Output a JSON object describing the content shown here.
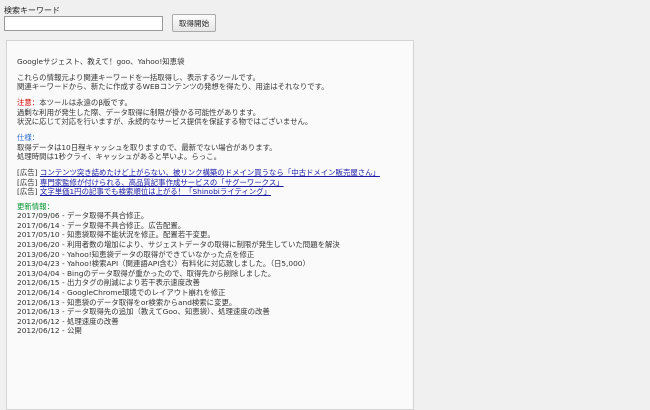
{
  "search": {
    "label": "検索キーワード",
    "value": "",
    "placeholder": "",
    "button_label": "取得開始"
  },
  "intro": {
    "title": "Googleサジェスト、教えて！goo、Yahoo!知恵袋",
    "desc_line1": "これらの情報元より関連キーワードを一括取得し、表示するツールです。",
    "desc_line2": "関連キーワードから、新たに作成するWEBコンテンツの発想を得たり、用途はそれなりです。"
  },
  "notice": {
    "label": "注意：",
    "line1": "本ツールは永遠のβ版です。",
    "line2": "過剰な利用が発生した際、データ取得に制限が掛かる可能性があります。",
    "line3": "状況に応じて対応を行いますが、永続的なサービス提供を保証する物ではございません。"
  },
  "spec": {
    "label": "仕様：",
    "line1": "取得データは10日程キャッシュを取りますので、最新でない場合があります。",
    "line2": "処理時間は1秒クライ、キャッシュがあると早いよ。らっこ。"
  },
  "ads": [
    {
      "tag": "[広告]",
      "text": "コンテンツ突き詰めたけど上がらない、被リンク構築のドメイン買うなら「中古ドメイン販売屋さん」"
    },
    {
      "tag": "[広告]",
      "text": "専門家監修が付けられる、高品質記事作成サービスの「サグーワークス」"
    },
    {
      "tag": "[広告]",
      "text": "文字単価1円の記事でも検索順位は上がる！「Shinobiライティング」"
    }
  ],
  "changelog": {
    "label": "更新情報：",
    "entries": [
      "2017/09/06 - データ取得不具合修正。",
      "2017/06/14 - データ取得不具合修正。広告配置。",
      "2017/05/10 - 知恵袋取得不能状況を修正。配置若干変更。",
      "2013/06/20 - 利用者数の増加により、サジェストデータの取得に制限が発生していた問題を解決",
      "2013/06/20 - Yahoo!知恵袋データの取得ができていなかった点を修正",
      "2013/04/23 - Yahoo!検索API（関連語API含む）有料化に対応致しました。（日5,000）",
      "2013/04/04 - Bingのデータ取得が重かったので、取得先から削除しました。",
      "2012/06/15 - 出力タグの削減により若干表示速度改善",
      "2012/06/14 - GoogleChrome環境でのレイアウト崩れを修正",
      "2012/06/13 - 知恵袋のデータ取得をor検索からand検索に変更。",
      "2012/06/13 - データ取得先の追加（教えてGoo、知恵袋）、処理速度の改善",
      "2012/06/12 - 処理速度の改善",
      "2012/06/12 - 公開"
    ]
  },
  "colors": {
    "notice": "#d40000",
    "spec": "#2f6fd1",
    "changelog": "#00962d",
    "link": "#1a1aa6"
  }
}
